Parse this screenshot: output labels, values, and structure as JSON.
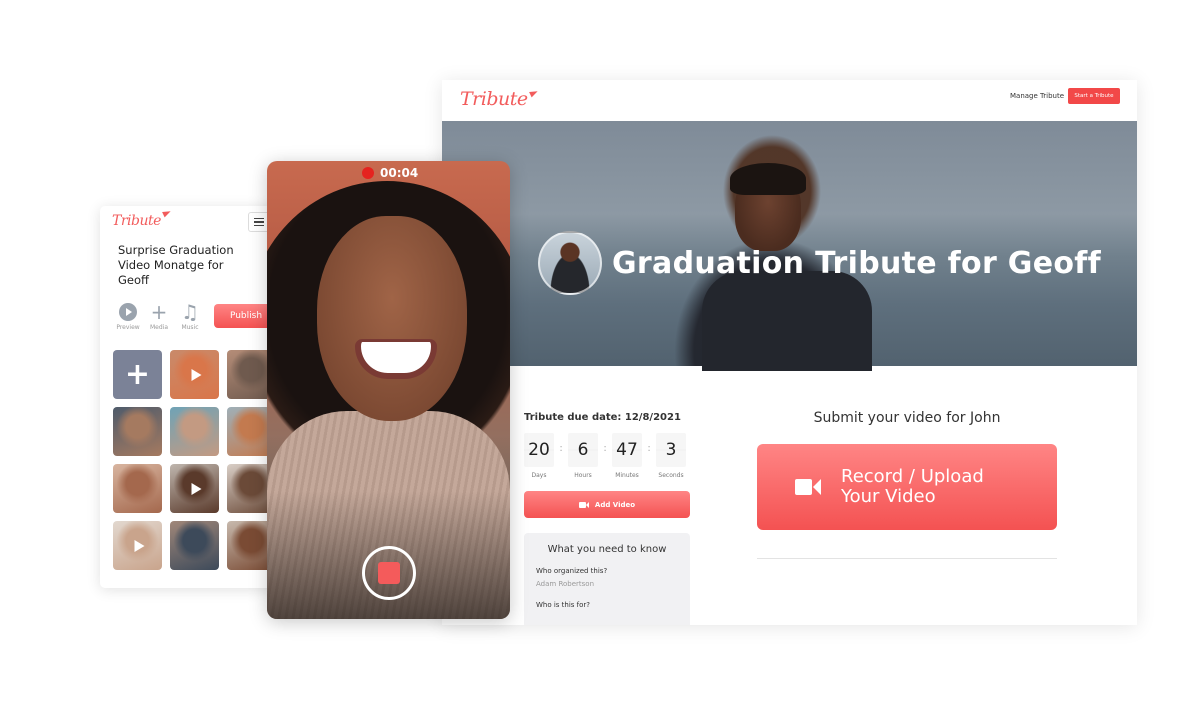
{
  "desktop": {
    "logo": "Tribute",
    "nav": {
      "manage_label": "Manage Tribute",
      "start_label": "Start a Tribute"
    },
    "hero": {
      "title": "Graduation Tribute for Geoff"
    },
    "due_date_label": "Tribute due date: 12/8/2021",
    "countdown": [
      {
        "value": "20",
        "label": "Days"
      },
      {
        "value": "6",
        "label": "Hours"
      },
      {
        "value": "47",
        "label": "Minutes"
      },
      {
        "value": "3",
        "label": "Seconds"
      }
    ],
    "countdown_separator": ":",
    "add_video_label": "Add Video",
    "know": {
      "title": "What you need to know",
      "items": [
        {
          "question": "Who organized this?",
          "answer": "Adam Robertson"
        },
        {
          "question": "Who is this for?",
          "answer": ""
        }
      ]
    },
    "submit_title": "Submit your video for  John",
    "record_label_line1": "Record / Upload",
    "record_label_line2": "Your  Video"
  },
  "mobile": {
    "logo": "Tribute",
    "title": "Surprise Graduation Video Monatge for Geoff",
    "tools": [
      {
        "icon": "play-circle-icon",
        "label": "Preview"
      },
      {
        "icon": "plus-icon",
        "glyph": "+",
        "label": "Media"
      },
      {
        "icon": "music-note-icon",
        "glyph": "♫",
        "label": "Music"
      }
    ],
    "publish_label": "Publish",
    "add_tile_glyph": "+",
    "tiles": [
      {
        "type": "video",
        "colors": [
          "#c98a6a",
          "#d9764a"
        ]
      },
      {
        "type": "photo",
        "colors": [
          "#b58d78",
          "#6f5a4e"
        ]
      },
      {
        "type": "photo",
        "colors": [
          "#4e5b6b",
          "#a57a60"
        ]
      },
      {
        "type": "photo",
        "colors": [
          "#6fa3b6",
          "#c39a82"
        ]
      },
      {
        "type": "photo",
        "colors": [
          "#9fb0b8",
          "#c37a4f"
        ]
      },
      {
        "type": "photo",
        "colors": [
          "#d8b5a0",
          "#a4684d"
        ]
      },
      {
        "type": "video",
        "colors": [
          "#bfb6ae",
          "#5a3a2b"
        ]
      },
      {
        "type": "photo",
        "colors": [
          "#d9cfc7",
          "#6b4a38"
        ]
      },
      {
        "type": "video",
        "colors": [
          "#e2d8cf",
          "#c9a48c"
        ]
      },
      {
        "type": "photo",
        "colors": [
          "#a08779",
          "#3d4a5a"
        ]
      },
      {
        "type": "photo",
        "colors": [
          "#c7b9ad",
          "#7a4b34"
        ]
      }
    ]
  },
  "phone": {
    "timer": "00:04",
    "recording": true
  }
}
